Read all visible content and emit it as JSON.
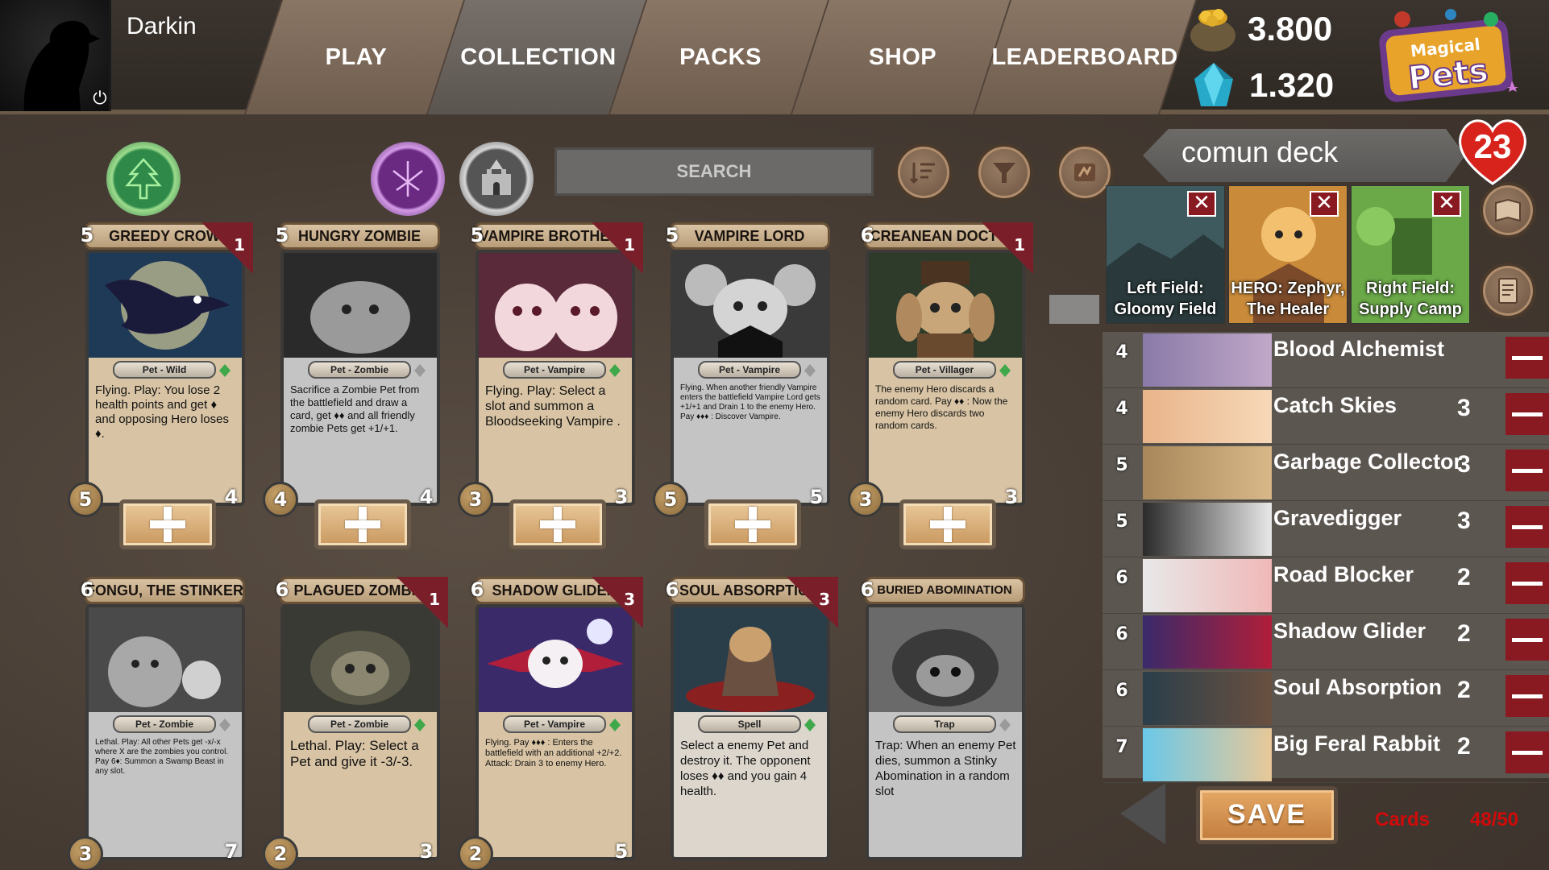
{
  "player": {
    "name": "Darkin"
  },
  "nav": [
    {
      "label": "PLAY"
    },
    {
      "label": "COLLECTION"
    },
    {
      "label": "PACKS"
    },
    {
      "label": "SHOP"
    },
    {
      "label": "LEADERBOARD"
    }
  ],
  "currency": {
    "gold": "3.800",
    "gems": "1.320"
  },
  "logo": {
    "text": "Magical Pets"
  },
  "filters": {
    "search_placeholder": "SEARCH"
  },
  "cards_row1": [
    {
      "name": "GREEDY CROW",
      "cost": "5",
      "copies": "1",
      "type": "Pet - Wild",
      "text": "Flying. Play: You lose 2 health points and get ♦ and opposing Hero loses ♦.",
      "atk": "5",
      "hp": "4"
    },
    {
      "name": "HUNGRY ZOMBIE",
      "cost": "5",
      "copies": "",
      "type": "Pet - Zombie",
      "text": "Sacrifice a Zombie Pet from the battlefield and draw a card, get ♦♦ and all friendly zombie Pets get +1/+1.",
      "atk": "4",
      "hp": "4"
    },
    {
      "name": "VAMPIRE BROTHERS",
      "cost": "5",
      "copies": "1",
      "type": "Pet - Vampire",
      "text": "Flying. Play: Select a slot and summon a Bloodseeking Vampire .",
      "atk": "3",
      "hp": "3"
    },
    {
      "name": "VAMPIRE LORD",
      "cost": "5",
      "copies": "",
      "type": "Pet - Vampire",
      "text": "Flying. When another friendly Vampire enters the battlefield Vampire Lord gets +1/+1 and Drain 1 to the enemy Hero. Pay ♦♦♦ : Discover Vampire.",
      "atk": "5",
      "hp": "5"
    },
    {
      "name": "CREANEAN DOCTOR",
      "cost": "6",
      "copies": "1",
      "type": "Pet - Villager",
      "text": "The enemy Hero discards a random card. Pay ♦♦ : Now the enemy Hero discards two random cards.",
      "atk": "3",
      "hp": "3"
    }
  ],
  "cards_row2": [
    {
      "name": "FONGU, THE STINKER",
      "cost": "6",
      "copies": "",
      "type": "Pet - Zombie",
      "text": "Lethal. Play: All other Pets get -x/-x where X are the zombies you control. Pay 6♦: Summon a Swamp Beast in any slot.",
      "atk": "3",
      "hp": "7"
    },
    {
      "name": "PLAGUED ZOMBIE",
      "cost": "6",
      "copies": "1",
      "type": "Pet - Zombie",
      "text": "Lethal. Play: Select a Pet and give it -3/-3.",
      "atk": "2",
      "hp": "3"
    },
    {
      "name": "SHADOW GLIDER",
      "cost": "6",
      "copies": "3",
      "type": "Pet - Vampire",
      "text": "Flying. Pay ♦♦♦ : Enters the battlefield with an additional +2/+2. Attack: Drain 3 to enemy Hero.",
      "atk": "2",
      "hp": "5"
    },
    {
      "name": "SOUL ABSORPTION",
      "cost": "6",
      "copies": "3",
      "type": "Spell",
      "text": "Select a enemy Pet and destroy it. The opponent loses ♦♦ and you gain 4 health.",
      "atk": "",
      "hp": ""
    },
    {
      "name": "BURIED ABOMINATION",
      "cost": "6",
      "copies": "",
      "type": "Trap",
      "text": "Trap: When an enemy Pet dies, summon a Stinky Abomination in a random slot",
      "atk": "",
      "hp": ""
    }
  ],
  "deck": {
    "name": "comun deck",
    "count_badge": "23",
    "slots": [
      {
        "label": "Left Field: Gloomy Field"
      },
      {
        "label": "HERO: Zephyr, The Healer"
      },
      {
        "label": "Right Field: Supply Camp"
      }
    ],
    "list": [
      {
        "cost": "4",
        "name": "Blood Alchemist",
        "qty": ""
      },
      {
        "cost": "4",
        "name": "Catch Skies",
        "qty": "3"
      },
      {
        "cost": "5",
        "name": "Garbage Collector",
        "qty": "3"
      },
      {
        "cost": "5",
        "name": "Gravedigger",
        "qty": "3"
      },
      {
        "cost": "6",
        "name": "Road Blocker",
        "qty": "2"
      },
      {
        "cost": "6",
        "name": "Shadow Glider",
        "qty": "2"
      },
      {
        "cost": "6",
        "name": "Soul Absorption",
        "qty": "2"
      },
      {
        "cost": "7",
        "name": "Big Feral Rabbit",
        "qty": "2"
      }
    ],
    "save_label": "SAVE",
    "cards_label": "Cards",
    "cards_count": "48/50"
  },
  "colors": {
    "accent_red": "#d10a0a",
    "remove_red": "#8a1a22",
    "rarity_green": "#3fa84a"
  }
}
